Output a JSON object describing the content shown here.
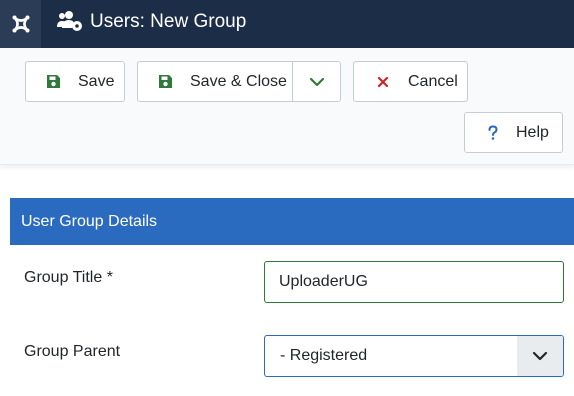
{
  "header": {
    "title": "Users: New Group",
    "logo_icon": "joomla-logo-icon",
    "title_icon": "users-cog-icon",
    "background": "#1c2d47"
  },
  "toolbar": {
    "save_label": "Save",
    "save_close_label": "Save & Close",
    "cancel_label": "Cancel",
    "help_label": "Help",
    "save_icon": "floppy-disk-icon",
    "cancel_icon": "x-icon",
    "help_icon": "question-icon",
    "dropdown_icon": "chevron-down-icon",
    "accent_green": "#2e7a3a",
    "cancel_red": "#c52827",
    "help_blue": "#2b6bbf"
  },
  "card": {
    "header": "User Group Details",
    "header_color": "#2b6bbf"
  },
  "form": {
    "group_title_label": "Group Title *",
    "group_title_value": "UploaderUG",
    "group_parent_label": "Group Parent",
    "group_parent_value": "- Registered"
  }
}
